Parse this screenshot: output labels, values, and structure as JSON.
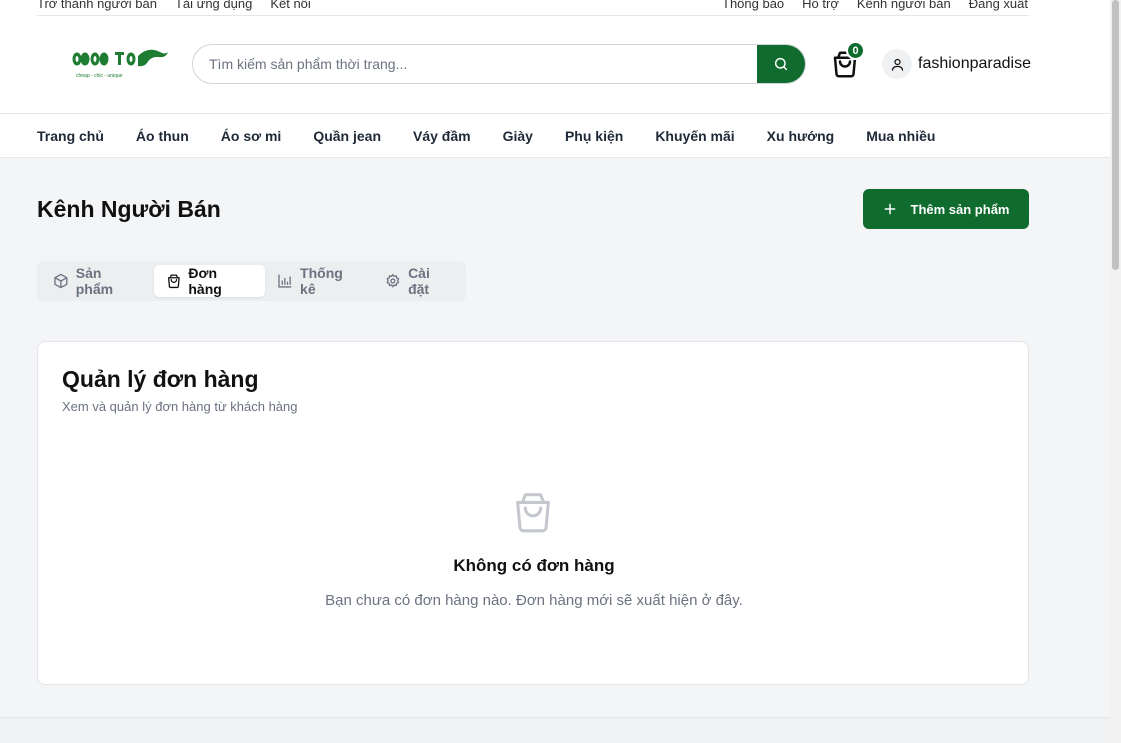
{
  "top_links": {
    "left": [
      "Trở thành người bán",
      "Tải ứng dụng",
      "Kết nối"
    ],
    "right": [
      "Thông báo",
      "Hỗ trợ",
      "Kênh người bán",
      "Đăng xuất"
    ]
  },
  "logo": {
    "tagline": "cheap - chic - unique"
  },
  "search": {
    "placeholder": "Tìm kiếm sản phẩm thời trang..."
  },
  "cart": {
    "count": "0"
  },
  "user": {
    "name": "fashionparadise"
  },
  "nav": {
    "items": [
      "Trang chủ",
      "Áo thun",
      "Áo sơ mi",
      "Quần jean",
      "Váy đầm",
      "Giày",
      "Phụ kiện",
      "Khuyến mãi",
      "Xu hướng",
      "Mua nhiều"
    ]
  },
  "page": {
    "title": "Kênh Người Bán",
    "add_product_label": "Thêm sản phẩm"
  },
  "tabs": [
    {
      "label": "Sản phẩm",
      "icon": "package-icon",
      "active": false
    },
    {
      "label": "Đơn hàng",
      "icon": "shopping-bag-icon",
      "active": true
    },
    {
      "label": "Thống kê",
      "icon": "bar-chart-icon",
      "active": false
    },
    {
      "label": "Cài đặt",
      "icon": "gear-icon",
      "active": false
    }
  ],
  "orders": {
    "title": "Quản lý đơn hàng",
    "subtitle": "Xem và quản lý đơn hàng từ khách hàng",
    "empty_title": "Không có đơn hàng",
    "empty_desc": "Bạn chưa có đơn hàng nào. Đơn hàng mới sẽ xuất hiện ở đây."
  },
  "colors": {
    "brand": "#0f6b2e",
    "muted": "#6b7280",
    "background": "#f4f5f7"
  }
}
